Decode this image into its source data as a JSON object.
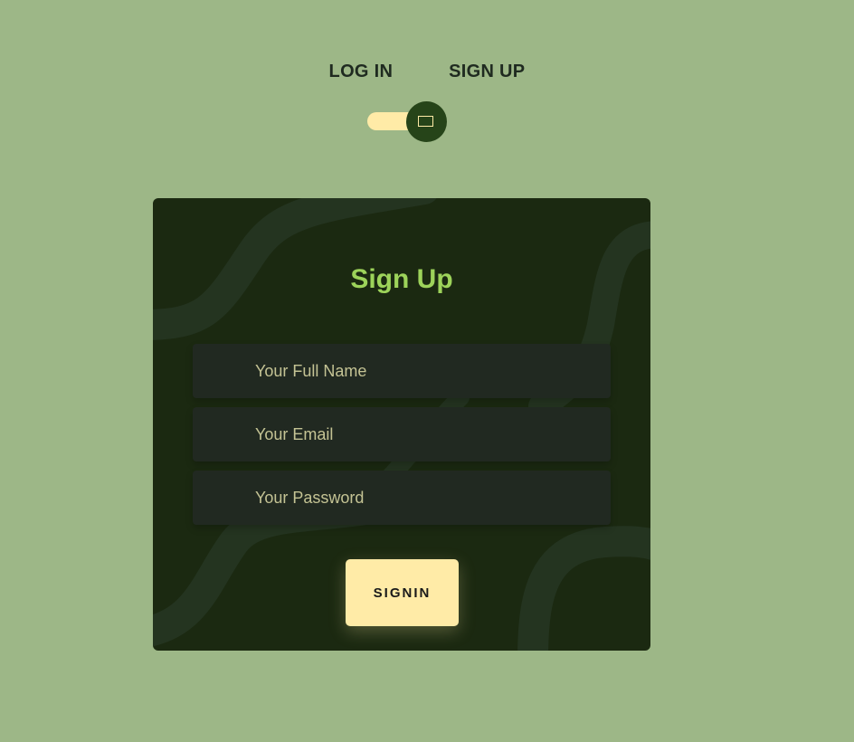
{
  "tabs": {
    "login_label": "LOG IN",
    "signup_label": "SIGN UP"
  },
  "toggle": {
    "state": "signup",
    "icon": "rectangle-outline-icon"
  },
  "form": {
    "title": "Sign Up",
    "full_name_placeholder": "Your Full Name",
    "email_placeholder": "Your Email",
    "password_placeholder": "Your Password",
    "submit_label": "SIGNIN"
  },
  "colors": {
    "page_background": "#9db787",
    "card_background": "#1b2911",
    "accent": "#ffeba7",
    "title": "#9dd35a",
    "field_background": "#212921",
    "field_text": "#c4c394",
    "knob": "#264419"
  }
}
